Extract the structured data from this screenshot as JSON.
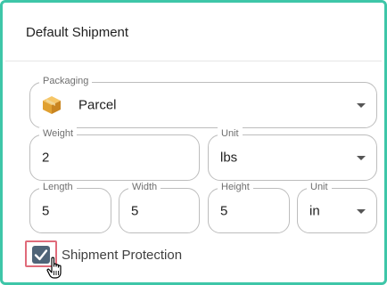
{
  "header": {
    "title": "Default Shipment"
  },
  "packaging": {
    "label": "Packaging",
    "value": "Parcel",
    "icon": "parcel-box-icon"
  },
  "weight": {
    "label": "Weight",
    "value": "2"
  },
  "weight_unit": {
    "label": "Unit",
    "value": "lbs"
  },
  "length": {
    "label": "Length",
    "value": "5"
  },
  "width": {
    "label": "Width",
    "value": "5"
  },
  "height": {
    "label": "Height",
    "value": "5"
  },
  "dim_unit": {
    "label": "Unit",
    "value": "in"
  },
  "protection": {
    "label": "Shipment Protection",
    "checked": true
  },
  "colors": {
    "frame": "#3ec6a8",
    "checkbox": "#4f6478",
    "highlight": "#e06b7a"
  }
}
